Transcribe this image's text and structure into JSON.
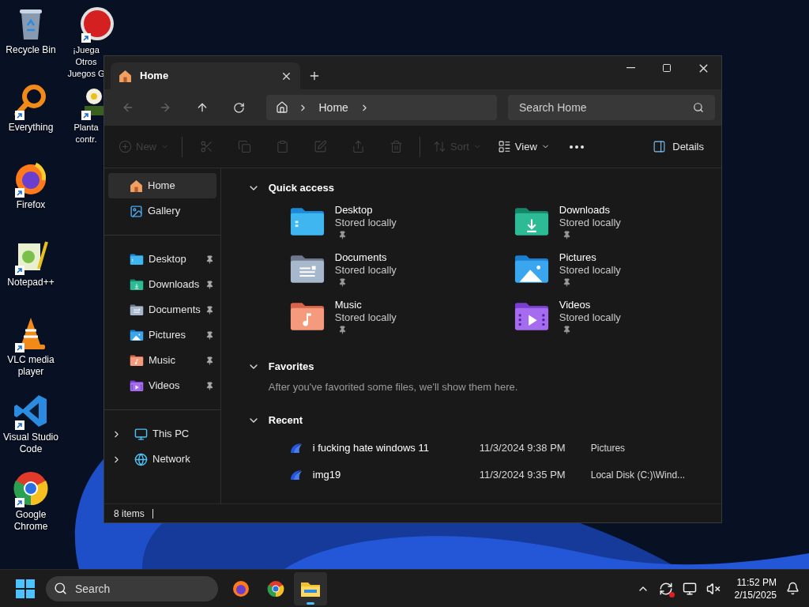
{
  "desktop": {
    "columns": [
      [
        {
          "label": "Recycle Bin",
          "kind": "recycle",
          "shortcut": false
        },
        {
          "label": "Everything",
          "kind": "everything",
          "shortcut": true
        },
        {
          "label": "Firefox",
          "kind": "firefox",
          "shortcut": true
        },
        {
          "label": "Notepad++",
          "kind": "notepad",
          "shortcut": true
        },
        {
          "label": "VLC media player",
          "kind": "vlc",
          "shortcut": true
        },
        {
          "label": "Visual Studio Code",
          "kind": "vscode",
          "shortcut": true
        },
        {
          "label": "Google Chrome",
          "kind": "chrome",
          "shortcut": true
        }
      ],
      [
        {
          "label": "¡Juega Otros Juegos G",
          "kind": "popcap",
          "shortcut": true
        },
        {
          "label": "Planta contr.",
          "kind": "plant",
          "shortcut": true
        }
      ]
    ]
  },
  "window": {
    "tabs": [
      {
        "title": "Home",
        "selected": true
      }
    ],
    "breadcrumb": [
      "Home"
    ],
    "search": {
      "placeholder": "Search Home"
    },
    "commands": [
      {
        "kind": "new",
        "label": "New",
        "disabled": true
      },
      {
        "kind": "cut",
        "disabled": true
      },
      {
        "kind": "copy",
        "disabled": true
      },
      {
        "kind": "paste",
        "disabled": true
      },
      {
        "kind": "rename",
        "disabled": true
      },
      {
        "kind": "share",
        "disabled": true
      },
      {
        "kind": "delete",
        "disabled": true
      },
      {
        "kind": "sort",
        "label": "Sort",
        "disabled": true
      },
      {
        "kind": "view",
        "label": "View",
        "disabled": false
      },
      {
        "kind": "more",
        "disabled": false
      }
    ],
    "details_button": "Details",
    "sidebar": {
      "top": [
        {
          "label": "Home",
          "kind": "home",
          "selected": true
        },
        {
          "label": "Gallery",
          "kind": "gallery",
          "selected": false
        }
      ],
      "pinned": [
        {
          "label": "Desktop",
          "kind": "desktop",
          "pinned": true,
          "selected": false
        },
        {
          "label": "Downloads",
          "kind": "downloads",
          "pinned": true,
          "selected": false
        },
        {
          "label": "Documents",
          "kind": "documents",
          "pinned": true,
          "selected": false
        },
        {
          "label": "Pictures",
          "kind": "pictures",
          "pinned": true,
          "selected": false
        },
        {
          "label": "Music",
          "kind": "music",
          "pinned": true,
          "selected": false
        },
        {
          "label": "Videos",
          "kind": "videos",
          "pinned": true,
          "selected": false
        }
      ],
      "drives": [
        {
          "label": "This PC",
          "kind": "pc",
          "expanded": false,
          "selected": false
        },
        {
          "label": "Network",
          "kind": "network",
          "expanded": false,
          "selected": false
        }
      ]
    },
    "quick_access": {
      "title": "Quick access",
      "expanded": true,
      "items": [
        {
          "name": "Desktop",
          "status": "Stored locally",
          "kind": "desktop",
          "pinned": true
        },
        {
          "name": "Downloads",
          "status": "Stored locally",
          "kind": "downloads",
          "pinned": true
        },
        {
          "name": "Documents",
          "status": "Stored locally",
          "kind": "documents",
          "pinned": true
        },
        {
          "name": "Pictures",
          "status": "Stored locally",
          "kind": "pictures",
          "pinned": true
        },
        {
          "name": "Music",
          "status": "Stored locally",
          "kind": "music",
          "pinned": true
        },
        {
          "name": "Videos",
          "status": "Stored locally",
          "kind": "videos",
          "pinned": true
        }
      ]
    },
    "favorites": {
      "title": "Favorites",
      "expanded": true,
      "empty_message": "After you've favorited some files, we'll show them here."
    },
    "recent": {
      "title": "Recent",
      "expanded": true,
      "files": [
        {
          "name": "i fucking hate windows 11",
          "date": "11/3/2024 9:38 PM",
          "location": "Pictures"
        },
        {
          "name": "img19",
          "date": "11/3/2024 9:35 PM",
          "location": "Local Disk (C:)\\Wind..."
        }
      ]
    },
    "status_bar": "8 items"
  },
  "taskbar": {
    "search_placeholder": "Search",
    "apps": [
      {
        "kind": "firefox",
        "active": false
      },
      {
        "kind": "chrome",
        "active": false
      },
      {
        "kind": "explorer",
        "active": true
      }
    ],
    "time": "11:52 PM",
    "date": "2/15/2025"
  }
}
